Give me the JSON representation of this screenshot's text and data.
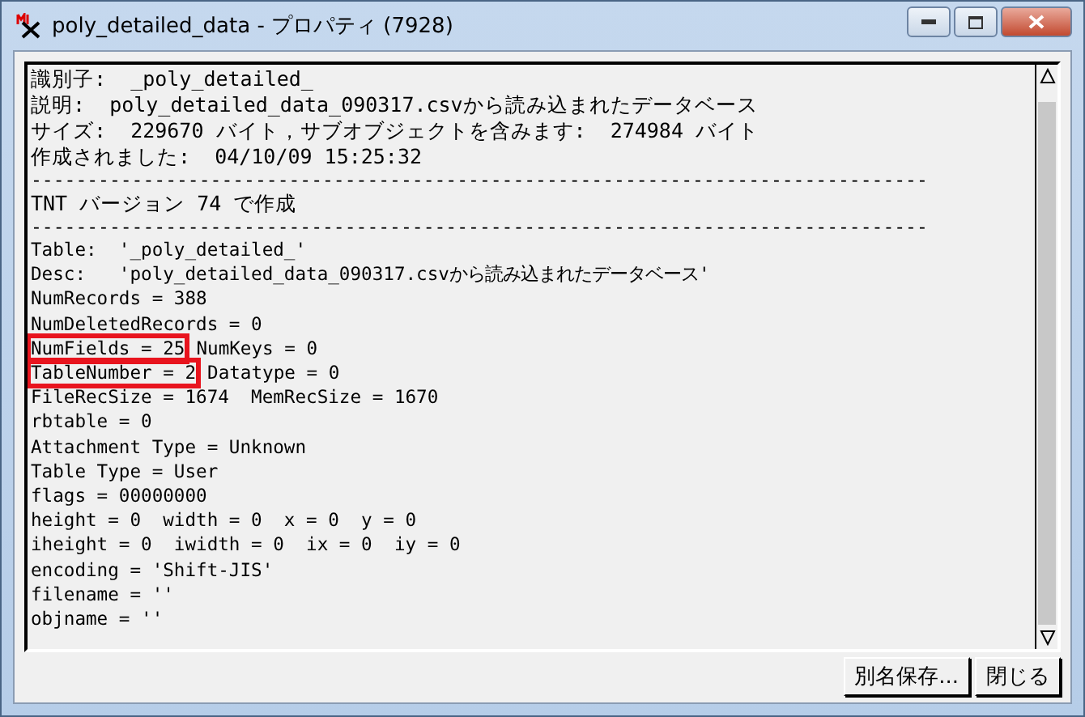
{
  "window": {
    "title": "poly_detailed_data - プロパティ (7928)"
  },
  "lines": [
    {
      "kind": "header",
      "text": "識別子:  _poly_detailed_",
      "highlighted": false
    },
    {
      "kind": "header",
      "text": "説明:  poly_detailed_data_090317.csvから読み込まれたデータベース",
      "highlighted": false
    },
    {
      "kind": "header",
      "text": "サイズ:  229670 バイト，サブオブジェクトを含みます:  274984 バイト",
      "highlighted": false
    },
    {
      "kind": "header",
      "text": "作成されました:  04/10/09 15:25:32",
      "highlighted": false
    },
    {
      "kind": "rule",
      "text": "--------------------------------------------------------------------------------",
      "highlighted": false
    },
    {
      "kind": "header",
      "text": "TNT バージョン 74 で作成",
      "highlighted": false
    },
    {
      "kind": "rule",
      "text": "--------------------------------------------------------------------------------",
      "highlighted": false
    },
    {
      "kind": "line",
      "text": "Table:  '_poly_detailed_'",
      "highlighted": false
    },
    {
      "kind": "line",
      "text": "Desc:   'poly_detailed_data_090317.csvから読み込まれたデータベース'",
      "highlighted": false
    },
    {
      "kind": "line",
      "text": "NumRecords = 388",
      "highlighted": false
    },
    {
      "kind": "line",
      "text": "NumDeletedRecords = 0",
      "highlighted": false
    },
    {
      "kind": "line",
      "text": "NumFields = 25",
      "highlighted": true,
      "tail": "NumKeys = 0"
    },
    {
      "kind": "line",
      "text": "TableNumber = 2",
      "highlighted": true,
      "tail": "Datatype = 0"
    },
    {
      "kind": "line",
      "text": "FileRecSize = 1674  MemRecSize = 1670",
      "highlighted": false
    },
    {
      "kind": "line",
      "text": "rbtable = 0",
      "highlighted": false
    },
    {
      "kind": "line",
      "text": "Attachment Type = Unknown",
      "highlighted": false
    },
    {
      "kind": "line",
      "text": "Table Type = User",
      "highlighted": false
    },
    {
      "kind": "line",
      "text": "flags = 00000000",
      "highlighted": false
    },
    {
      "kind": "line",
      "text": "height = 0  width = 0  x = 0  y = 0",
      "highlighted": false
    },
    {
      "kind": "line",
      "text": "iheight = 0  iwidth = 0  ix = 0  iy = 0",
      "highlighted": false
    },
    {
      "kind": "line",
      "text": "encoding = 'Shift-JIS'",
      "highlighted": false
    },
    {
      "kind": "line",
      "text": "filename = ''",
      "highlighted": false
    },
    {
      "kind": "line",
      "text": "objname = ''",
      "highlighted": false
    }
  ],
  "buttons": [
    "別名保存...",
    "閉じる"
  ]
}
